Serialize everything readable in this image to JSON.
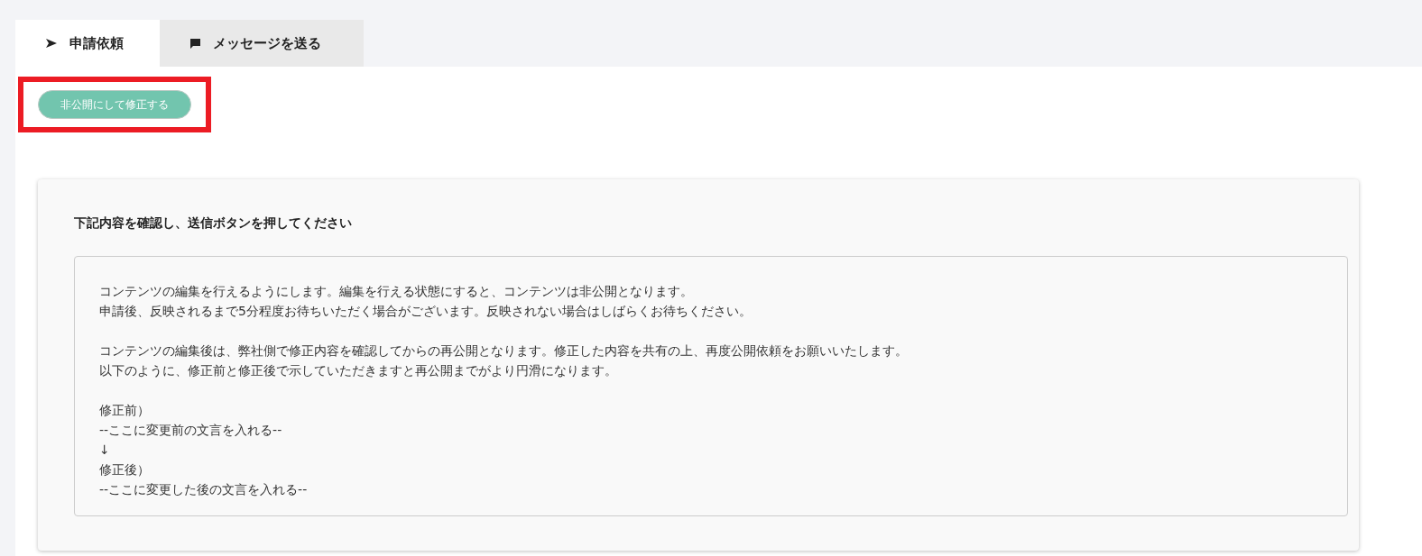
{
  "tabs": [
    {
      "label": "申請依頼",
      "kind": "send",
      "selected": true
    },
    {
      "label": "メッセージを送る",
      "kind": "message",
      "selected": false
    }
  ],
  "action_button": {
    "label": "非公開にして修正する",
    "highlighted": true
  },
  "card": {
    "title": "下記内容を確認し、送信ボタンを押してください",
    "paragraphs": [
      [
        "コンテンツの編集を行えるようにします。編集を行える状態にすると、コンテンツは非公開となります。",
        "申請後、反映されるまで5分程度お待ちいただく場合がございます。反映されない場合はしばらくお待ちください。"
      ],
      [
        "コンテンツの編集後は、弊社側で修正内容を確認してからの再公開となります。修正した内容を共有の上、再度公開依頼をお願いいたします。",
        "以下のように、修正前と修正後で示していただきますと再公開までがより円滑になります。"
      ],
      [
        "修正前）",
        "--ここに変更前の文言を入れる--",
        "↓",
        "修正後）",
        "--ここに変更した後の文言を入れる--"
      ]
    ]
  }
}
